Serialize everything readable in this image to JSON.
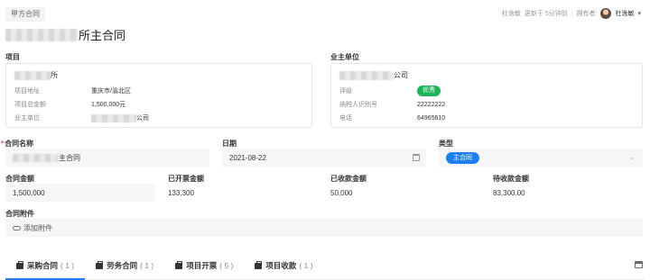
{
  "header": {
    "tag": "甲方合同",
    "updated_by": "杜逸敏",
    "updated_text": "更新于 5分钟前",
    "owner_label": "拥有者:",
    "owner_name": "杜逸敏",
    "title_visible": "所主合同"
  },
  "project": {
    "section": "项目",
    "name_visible": "所",
    "rows": [
      {
        "k": "项目地址",
        "v": "重庆市/渝北区"
      },
      {
        "k": "项目总金额",
        "v": "1,500,000元"
      },
      {
        "k": "业主单位",
        "v": "公司"
      }
    ]
  },
  "owner_unit": {
    "section": "业主单位",
    "name_visible": "公司",
    "rows": [
      {
        "k": "评级",
        "v": "优秀"
      },
      {
        "k": "纳税人识别号",
        "v": "22222222"
      },
      {
        "k": "电话",
        "v": "64965610"
      }
    ]
  },
  "form": {
    "contract_name_label": "合同名称",
    "contract_name_value": "主合同",
    "date_label": "日期",
    "date_value": "2021-08-22",
    "type_label": "类型",
    "type_value": "主合同",
    "amount_label": "合同金额",
    "amount_value": "1,500,000",
    "invoiced_label": "已开票金额",
    "invoiced_value": "133,300",
    "received_label": "已收款金额",
    "received_value": "50,000",
    "pending_label": "待收款金额",
    "pending_value": "83,300.00",
    "attachment_label": "合同附件",
    "add_attachment": "添加附件"
  },
  "tabs": [
    {
      "label": "采购合同",
      "count": "( 1 )"
    },
    {
      "label": "劳务合同",
      "count": "( 1 )"
    },
    {
      "label": "项目开票",
      "count": "( 5 )"
    },
    {
      "label": "项目收款",
      "count": "( 1 )"
    }
  ],
  "colors": {
    "accent": "#1e80f0",
    "success": "#21b35c",
    "required": "#e34d59"
  }
}
